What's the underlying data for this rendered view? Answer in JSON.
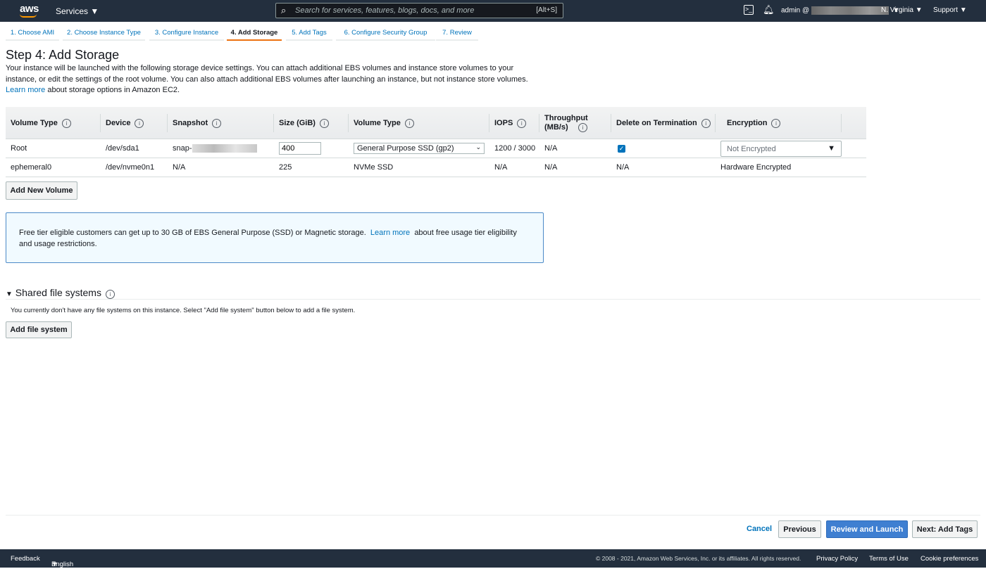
{
  "topbar": {
    "logo": "aws",
    "services": "Services",
    "search_placeholder": "Search for services, features, blogs, docs, and more",
    "search_shortcut": "[Alt+S]",
    "user": "admin @",
    "region": "N. Virginia",
    "support": "Support"
  },
  "tabs": [
    "1. Choose AMI",
    "2. Choose Instance Type",
    "3. Configure Instance",
    "4. Add Storage",
    "5. Add Tags",
    "6. Configure Security Group",
    "7. Review"
  ],
  "page": {
    "title": "Step 4: Add Storage",
    "desc": "Your instance will be launched with the following storage device settings. You can attach additional EBS volumes and instance store volumes to your instance, or edit the settings of the root volume. You can also attach additional EBS volumes after launching an instance, but not instance store volumes.",
    "desc_link": "Learn more",
    "desc_tail": "about storage options in Amazon EC2."
  },
  "table": {
    "headers": [
      "Volume Type",
      "Device",
      "Snapshot",
      "Size (GiB)",
      "Volume Type",
      "IOPS",
      "Throughput (MB/s)",
      "Delete on Termination",
      "Encryption"
    ],
    "root": {
      "type": "Root",
      "device": "/dev/sda1",
      "snapshot": "snap-",
      "size": "400",
      "volume_type": "General Purpose SSD (gp2)",
      "iops": "1200 / 3000",
      "throughput": "N/A",
      "delete_on_termination": true,
      "encryption": "Not Encrypted"
    },
    "ephemeral": {
      "type": "ephemeral0",
      "device": "/dev/nvme0n1",
      "snapshot": "N/A",
      "size": "225",
      "volume_type": "NVMe SSD",
      "iops": "N/A",
      "throughput": "N/A",
      "delete_on_termination": "N/A",
      "encryption": "Hardware Encrypted"
    }
  },
  "add_volume": "Add New Volume",
  "notice": {
    "text": "Free tier eligible customers can get up to 30 GB of EBS General Purpose (SSD) or Magnetic storage.",
    "link": "Learn more",
    "tail": "about free usage tier eligibility and usage restrictions."
  },
  "shared": {
    "title": "Shared file systems",
    "text": "You currently don't have any file systems on this instance. Select \"Add file system\" button below to add a file system.",
    "button": "Add file system"
  },
  "actions": {
    "cancel": "Cancel",
    "previous": "Previous",
    "review": "Review and Launch",
    "next": "Next: Add Tags"
  },
  "footer": {
    "feedback": "Feedback",
    "language": "English (US)",
    "copyright": "© 2008 - 2021, Amazon Web Services, Inc. or its affiliates. All rights reserved.",
    "privacy": "Privacy Policy",
    "terms": "Terms of Use",
    "cookies": "Cookie preferences"
  }
}
